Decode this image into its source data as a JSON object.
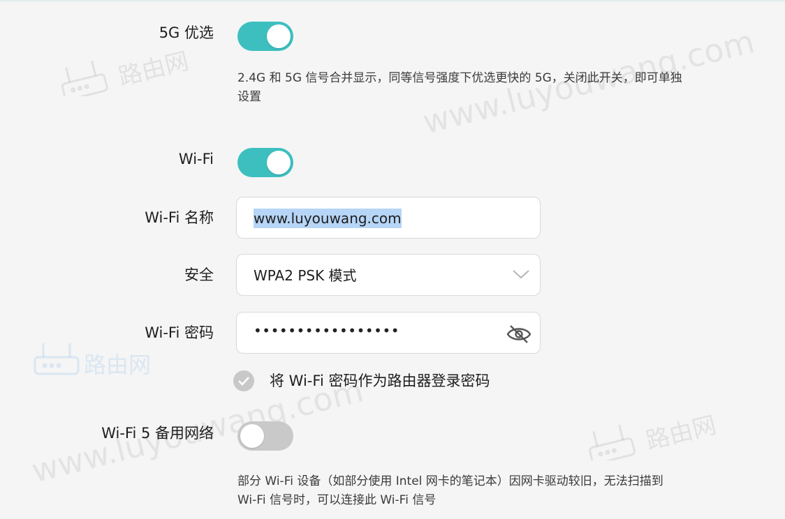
{
  "settings": {
    "five_g_preferred": {
      "label": "5G 优选",
      "enabled": true,
      "description": "2.4G 和 5G 信号合并显示，同等信号强度下优选更快的 5G，关闭此开关，即可单独设置"
    },
    "wifi": {
      "label": "Wi-Fi",
      "enabled": true
    },
    "wifi_name": {
      "label": "Wi-Fi 名称",
      "value": "www.luyouwang.com"
    },
    "security": {
      "label": "安全",
      "value": "WPA2 PSK 模式"
    },
    "wifi_password": {
      "label": "Wi-Fi 密码",
      "masked_value": "•••••••••••••••••"
    },
    "use_as_login": {
      "label": "将 Wi-Fi 密码作为路由器登录密码",
      "checked": true
    },
    "wifi5_backup": {
      "label": "Wi-Fi 5 备用网络",
      "enabled": false,
      "description": "部分 Wi-Fi 设备（如部分使用 Intel 网卡的笔记本）因网卡驱动较旧，无法扫描到 Wi-Fi 信号时，可以连接此 Wi-Fi 信号"
    }
  },
  "watermark": {
    "text": "www.luyouwang.com",
    "brand": "路由网"
  },
  "colors": {
    "toggle_on": "#3dbfbf",
    "toggle_off": "#c9c9c9",
    "background": "#f5f5f5",
    "selection": "#b6d5f7"
  }
}
